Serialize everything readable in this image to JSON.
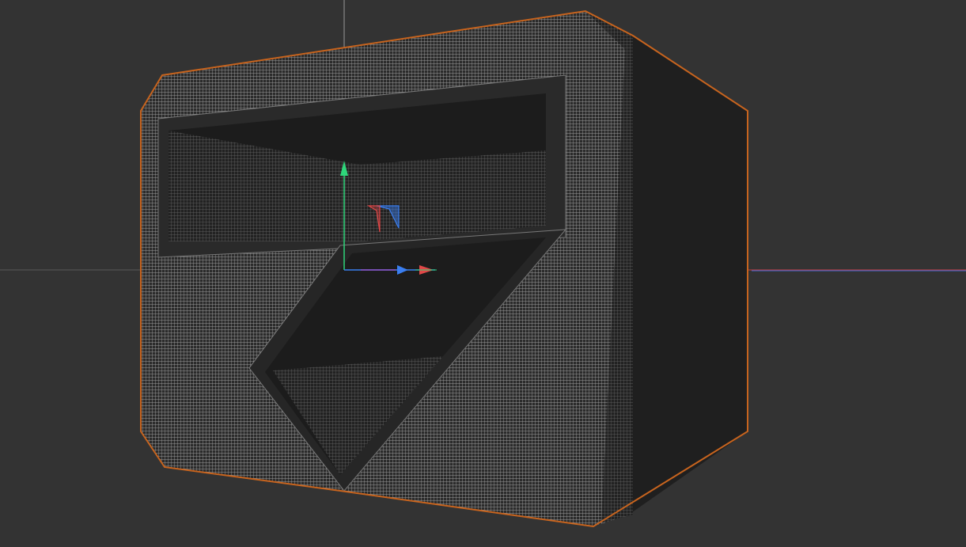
{
  "viewport": {
    "background": "#333333",
    "selection_outline": "#c8641e",
    "mesh_line_color": "#9a9a9a",
    "mesh_fill": "#2b2b2b",
    "interior_fill": "#1c1c1c",
    "side_fill": "#1f1f1f"
  },
  "gizmo": {
    "icons": [
      "move-gizmo-icon",
      "x-axis-arrow-icon",
      "y-axis-arrow-icon",
      "z-axis-arrow-icon",
      "plane-handle-icon"
    ],
    "x_color": "#e04848",
    "y_color": "#2ed67a",
    "z_color": "#3a7ef0"
  },
  "grid_axes": {
    "x_axis_color": "#c83c3c",
    "z_axis_color": "#3a6ee0",
    "y_axis_color": "#9a9a9a"
  }
}
